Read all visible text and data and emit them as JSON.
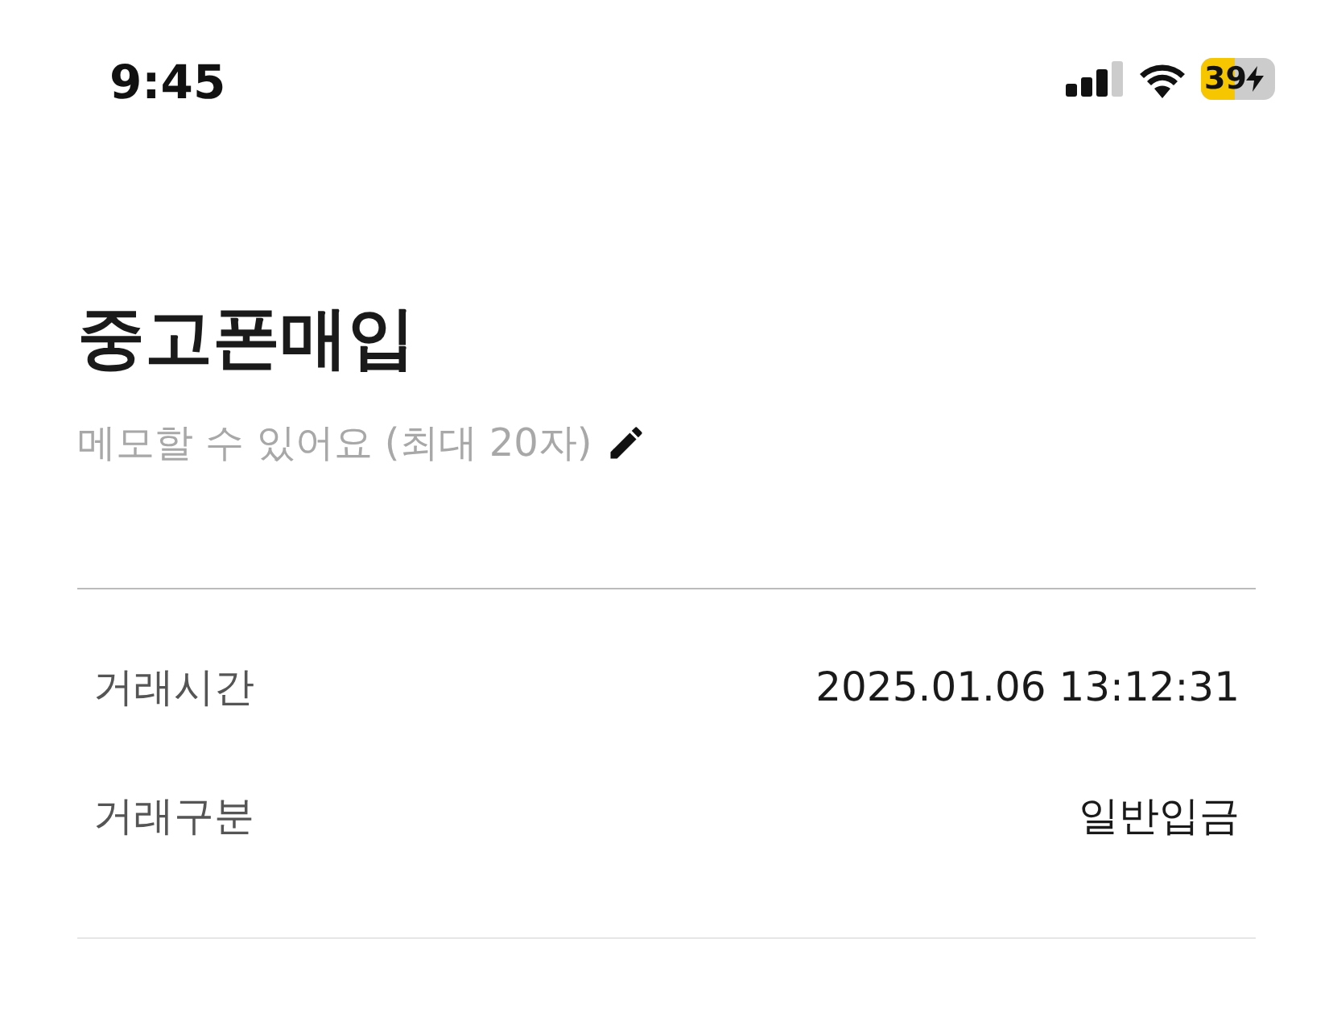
{
  "status_bar": {
    "time": "9:45",
    "battery": "39"
  },
  "title": "중고폰매입",
  "memo": {
    "hint": "메모할 수 있어요 (최대 20자)"
  },
  "details": [
    {
      "label": "거래시간",
      "value": "2025.01.06 13:12:31"
    },
    {
      "label": "거래구분",
      "value": "일반입금"
    }
  ]
}
